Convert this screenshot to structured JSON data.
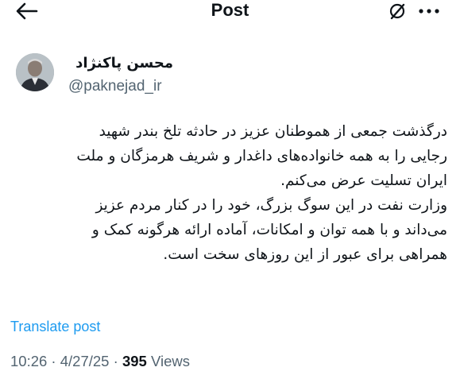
{
  "header": {
    "title": "Post",
    "back_icon": "arrow-left-icon",
    "grok_icon": "grok-icon",
    "more_icon": "more-horizontal-icon"
  },
  "author": {
    "display_name": "محسن پاکنژاد",
    "handle": "@paknejad_ir"
  },
  "tweet": {
    "lines": [
      "درگذشت جمعی از هموطنان عزیز در حادثه تلخ بندر شهید",
      "رجایی را به همه خانواده‌های داغدار و شریف هرمزگان و ملت",
      "ایران تسلیت عرض می‌کنم.",
      "وزارت نفت در این سوگ بزرگ، خود را در کنار مردم عزیز",
      "می‌داند و با همه توان و امکانات، آماده ارائه هرگونه کمک و",
      "همراهی برای عبور از این روزهای سخت است."
    ]
  },
  "translate_label": "Translate post",
  "meta": {
    "time": "10:26",
    "separator": " · ",
    "date": "4/27/25",
    "views_count": "395",
    "views_label": " Views"
  },
  "colors": {
    "text": "#0f1419",
    "secondary": "#536471",
    "link": "#1d9bf0"
  }
}
